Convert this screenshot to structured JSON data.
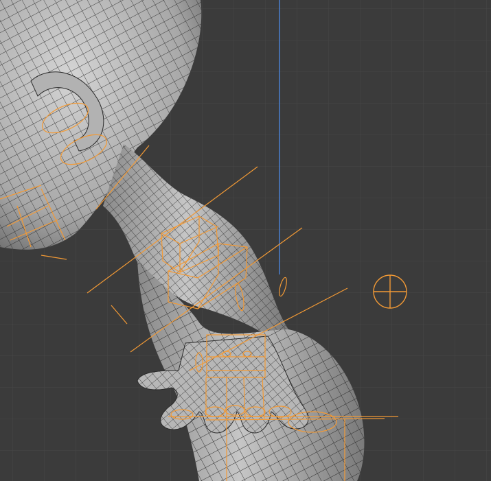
{
  "viewport": {
    "background": "#3b3b3b",
    "grid_color": "#474747",
    "axis_z_color": "#4a7fd0",
    "mesh_fill": "#b9b9b9",
    "mesh_wire": "#1f1f1f",
    "selection_color": "#f39a35"
  },
  "objects": {
    "character_mesh": "character-mesh",
    "armature": "armature-bones",
    "light_empty": "empty-object"
  }
}
